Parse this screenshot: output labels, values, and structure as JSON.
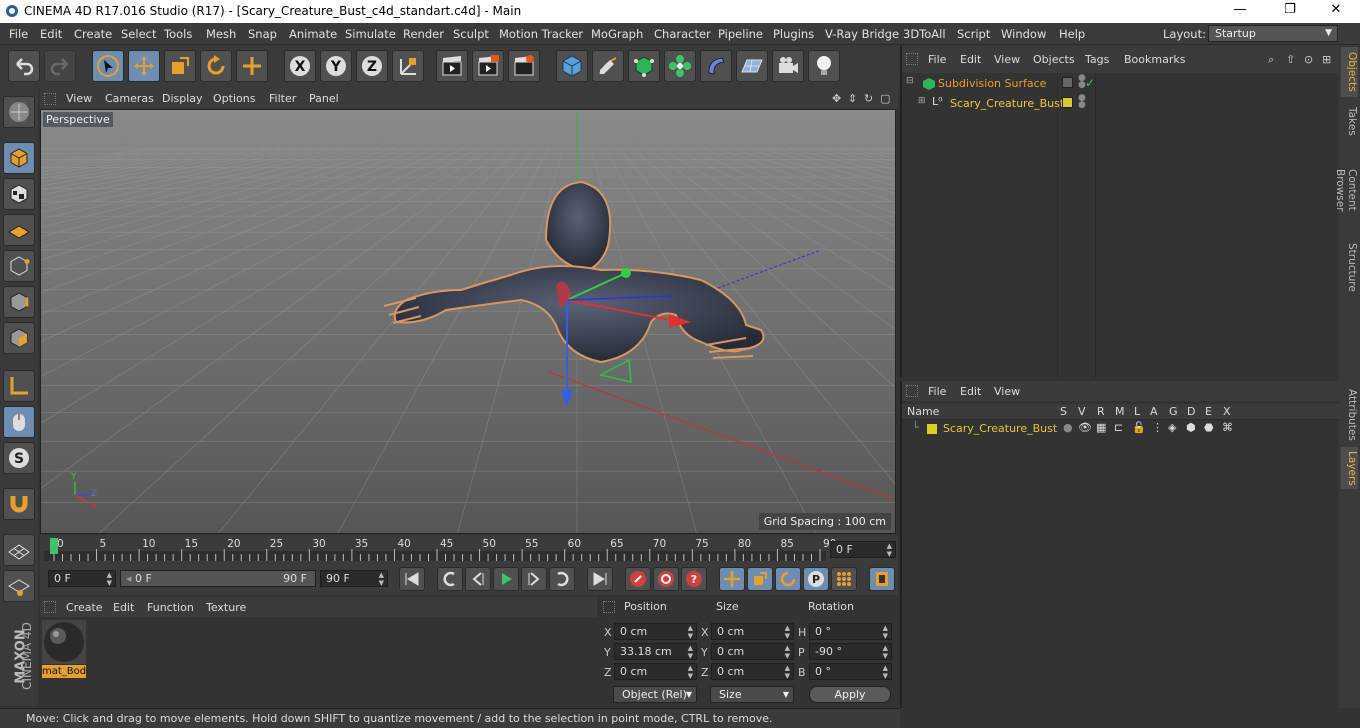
{
  "window": {
    "title": "CINEMA 4D R17.016 Studio (R17) - [Scary_Creature_Bust_c4d_standart.c4d] - Main",
    "minimize": "—",
    "maximize": "❐",
    "close": "✕"
  },
  "menubar": {
    "items": [
      "File",
      "Edit",
      "Create",
      "Select",
      "Tools",
      "Mesh",
      "Snap",
      "Animate",
      "Simulate",
      "Render",
      "Sculpt",
      "Motion Tracker",
      "MoGraph",
      "Character",
      "Pipeline",
      "Plugins",
      "V-Ray Bridge",
      "3DToAll",
      "Script",
      "Window",
      "Help"
    ],
    "layout_label": "Layout:",
    "layout_value": "Startup"
  },
  "viewport": {
    "menu": [
      "View",
      "Cameras",
      "Display",
      "Options",
      "Filter",
      "Panel"
    ],
    "camera_label": "Perspective",
    "grid_spacing": "Grid Spacing : 100 cm",
    "axis_labels": {
      "y": "Y",
      "z": "Z",
      "x": "X"
    }
  },
  "timeline": {
    "ticks": [
      "0",
      "5",
      "10",
      "15",
      "20",
      "25",
      "30",
      "35",
      "40",
      "45",
      "50",
      "55",
      "60",
      "65",
      "70",
      "75",
      "80",
      "85",
      "90"
    ],
    "current_frame": "0 F",
    "playhead_frame": 0
  },
  "transport": {
    "start_field": "0 F",
    "range_start": "0 F",
    "range_end": "90 F",
    "end_field": "90 F"
  },
  "material_manager": {
    "menu": [
      "Create",
      "Edit",
      "Function",
      "Texture"
    ],
    "material_name": "mat_Bod"
  },
  "coordinates": {
    "headers": {
      "position": "Position",
      "size": "Size",
      "rotation": "Rotation"
    },
    "axes": [
      "X",
      "Y",
      "Z"
    ],
    "rot_axes": [
      "H",
      "P",
      "B"
    ],
    "position": [
      "0 cm",
      "33.18 cm",
      "0 cm"
    ],
    "size": [
      "0 cm",
      "0 cm",
      "0 cm"
    ],
    "rotation": [
      "0 °",
      "-90 °",
      "0 °"
    ],
    "mode_dropdown": "Object (Rel)",
    "size_dropdown": "Size",
    "apply": "Apply"
  },
  "object_manager": {
    "menu": [
      "File",
      "Edit",
      "View",
      "Objects",
      "Tags",
      "Bookmarks"
    ],
    "objects": [
      {
        "name": "Subdivision Surface",
        "color": "#e6a02c"
      },
      {
        "name": "Scary_Creature_Bust",
        "color": "#f0c83c"
      }
    ]
  },
  "layer_manager": {
    "menu": [
      "File",
      "Edit",
      "View"
    ],
    "columns": [
      "Name",
      "S",
      "V",
      "R",
      "M",
      "L",
      "A",
      "G",
      "D",
      "E",
      "X"
    ],
    "layer_name": "Scary_Creature_Bust",
    "layer_color": "#d8d020"
  },
  "right_tabs": [
    "Objects",
    "Takes",
    "Content Browser",
    "Structure",
    "Attributes",
    "Layers"
  ],
  "status": "Move: Click and drag to move elements. Hold down SHIFT to quantize movement / add to the selection in point mode, CTRL to remove.",
  "brand": {
    "line1": "MAXON",
    "line2": "CINEMA 4D"
  },
  "colors": {
    "accent_orange": "#e6a02c",
    "selection_blue": "#6d8db3",
    "background": "#333333"
  }
}
